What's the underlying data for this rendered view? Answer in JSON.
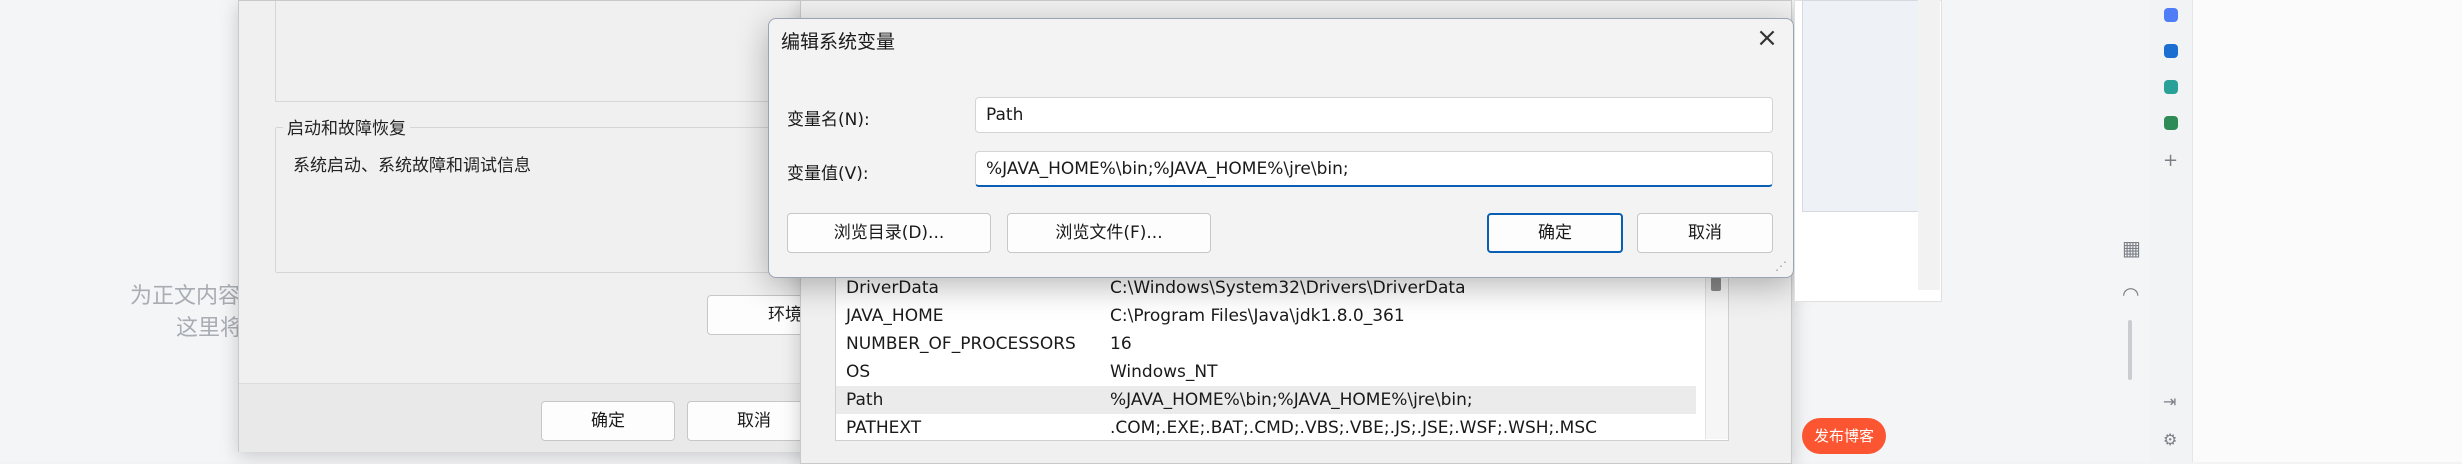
{
  "background": {
    "placeholder_line1": "为正文内容",
    "placeholder_line2": "这里将"
  },
  "system_properties": {
    "group_legend": "启动和故障恢复",
    "group_text": "系统启动、系统故障和调试信息",
    "env_button_partial": "环境",
    "ok_label": "确定",
    "cancel_label": "取消"
  },
  "env_list": {
    "rows": [
      {
        "name": "DriverData",
        "value": "C:\\Windows\\System32\\Drivers\\DriverData"
      },
      {
        "name": "JAVA_HOME",
        "value": "C:\\Program Files\\Java\\jdk1.8.0_361"
      },
      {
        "name": "NUMBER_OF_PROCESSORS",
        "value": "16"
      },
      {
        "name": "OS",
        "value": "Windows_NT"
      },
      {
        "name": "Path",
        "value": "%JAVA_HOME%\\bin;%JAVA_HOME%\\jre\\bin;",
        "selected": true
      },
      {
        "name": "PATHEXT",
        "value": ".COM;.EXE;.BAT;.CMD;.VBS;.VBE;.JS;.JSE;.WSF;.WSH;.MSC"
      }
    ]
  },
  "dialog": {
    "title": "编辑系统变量",
    "close_icon": "×",
    "name_label": "变量名(N):",
    "name_value": "Path",
    "value_label": "变量值(V):",
    "value_value": "%JAVA_HOME%\\bin;%JAVA_HOME%\\jre\\bin;",
    "browse_dir_label": "浏览目录(D)...",
    "browse_file_label": "浏览文件(F)...",
    "ok_label": "确定",
    "cancel_label": "取消",
    "accent_color": "#0a5fb4"
  },
  "right_app": {
    "publish_label": "发布博客",
    "publish_color": "#fc5531"
  }
}
